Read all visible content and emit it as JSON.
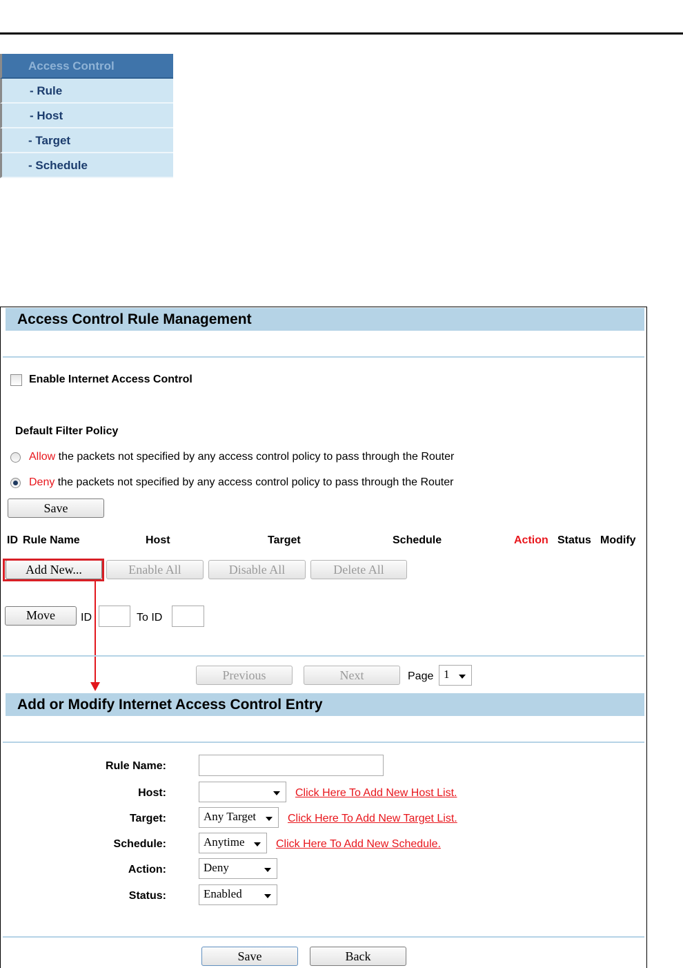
{
  "menu": {
    "items": [
      {
        "label": "Access Control"
      },
      {
        "label": "- Rule"
      },
      {
        "label": "- Host"
      },
      {
        "label": "- Target"
      },
      {
        "label": "- Schedule"
      }
    ]
  },
  "rule_mgmt": {
    "title": "Access Control Rule Management",
    "enable_label": "Enable Internet Access Control",
    "default_policy_label": "Default Filter Policy",
    "allow_word": "Allow",
    "allow_rest": " the packets not specified by any access control policy to pass through the Router",
    "deny_word": "Deny",
    "deny_rest": " the packets not specified by any access control policy to pass through the Router",
    "save_label": "Save",
    "columns": {
      "id": "ID",
      "rule_name": "Rule Name",
      "host": "Host",
      "target": "Target",
      "schedule": "Schedule",
      "action": "Action",
      "status": "Status",
      "modify": "Modify"
    },
    "add_new_label": "Add New...",
    "enable_all_label": "Enable All",
    "disable_all_label": "Disable All",
    "delete_all_label": "Delete All",
    "move_label": "Move",
    "id_label": "ID",
    "to_id_label": "To ID",
    "previous_label": "Previous",
    "next_label": "Next",
    "page_label": "Page",
    "page_value": "1"
  },
  "entry_form": {
    "title": "Add or Modify Internet Access Control Entry",
    "rule_name_label": "Rule Name:",
    "host_label": "Host:",
    "host_value": "",
    "host_link": "Click Here To Add New Host List.",
    "target_label": "Target:",
    "target_value": "Any Target",
    "target_link": "Click Here To Add New Target List.",
    "schedule_label": "Schedule:",
    "schedule_value": "Anytime",
    "schedule_link": "Click Here To Add New Schedule.",
    "action_label": "Action:",
    "action_value": "Deny",
    "status_label": "Status:",
    "status_value": "Enabled",
    "save_label": "Save",
    "back_label": "Back"
  },
  "colors": {
    "section_bar": "#b5d3e6",
    "menu_header": "#3f74aa",
    "menu_item": "#cfe6f3",
    "accent_red": "#e8161c"
  }
}
